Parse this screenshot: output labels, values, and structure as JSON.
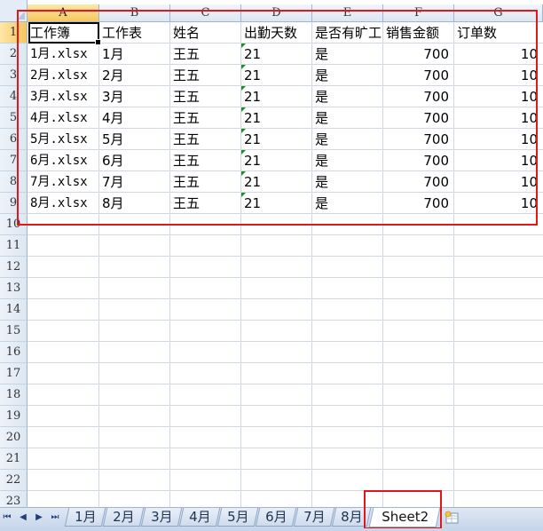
{
  "columns": [
    "A",
    "B",
    "C",
    "D",
    "E",
    "F",
    "G"
  ],
  "row_numbers": [
    "1",
    "2",
    "3",
    "4",
    "5",
    "6",
    "7",
    "8",
    "9",
    "10",
    "11",
    "12",
    "13",
    "14",
    "15",
    "16",
    "17",
    "18",
    "19",
    "20",
    "21",
    "22",
    "23"
  ],
  "header_row": [
    "工作簿",
    "工作表",
    "姓名",
    "出勤天数",
    "是否有旷工",
    "销售金额",
    "订单数"
  ],
  "rows": [
    [
      "1月.xlsx",
      "1月",
      "王五",
      "21",
      "是",
      "700",
      "10"
    ],
    [
      "2月.xlsx",
      "2月",
      "王五",
      "21",
      "是",
      "700",
      "10"
    ],
    [
      "3月.xlsx",
      "3月",
      "王五",
      "21",
      "是",
      "700",
      "10"
    ],
    [
      "4月.xlsx",
      "4月",
      "王五",
      "21",
      "是",
      "700",
      "10"
    ],
    [
      "5月.xlsx",
      "5月",
      "王五",
      "21",
      "是",
      "700",
      "10"
    ],
    [
      "6月.xlsx",
      "6月",
      "王五",
      "21",
      "是",
      "700",
      "10"
    ],
    [
      "7月.xlsx",
      "7月",
      "王五",
      "21",
      "是",
      "700",
      "10"
    ],
    [
      "8月.xlsx",
      "8月",
      "王五",
      "21",
      "是",
      "700",
      "10"
    ]
  ],
  "sheet_tabs": [
    "1月",
    "2月",
    "3月",
    "4月",
    "5月",
    "6月",
    "7月",
    "8月",
    "Sheet2"
  ],
  "active_tab": "Sheet2",
  "nav_buttons": {
    "first": "first-sheet-icon",
    "prev": "prev-sheet-icon",
    "next": "next-sheet-icon",
    "last": "last-sheet-icon",
    "insert": "insert-sheet-icon"
  },
  "colors": {
    "highlight_box": "#e3161b",
    "active_header": "#f6c660",
    "gridline": "#d0d7e5",
    "number_flag": "#1a8a2a"
  }
}
